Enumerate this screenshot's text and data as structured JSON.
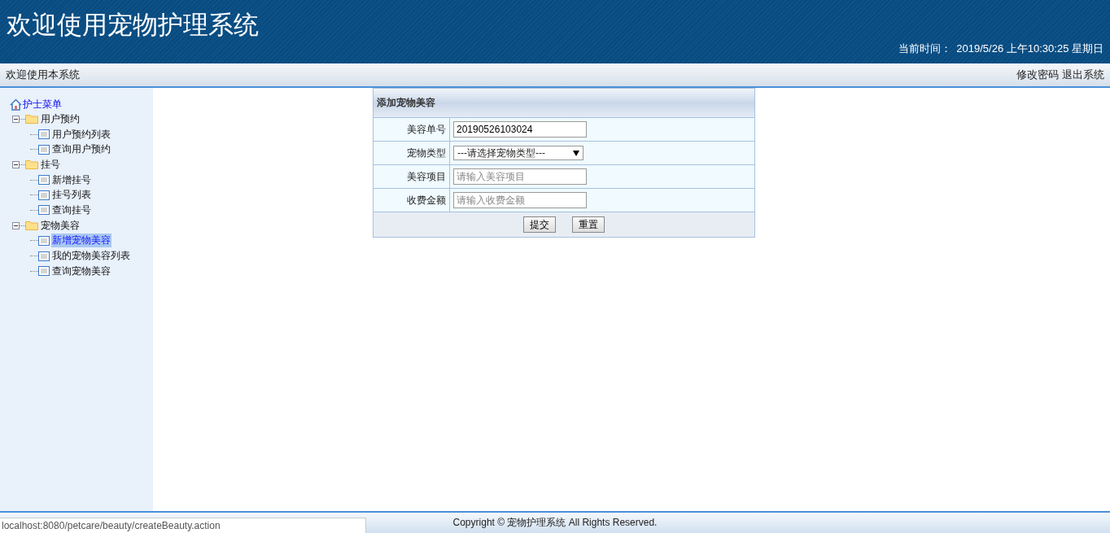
{
  "header": {
    "title": "欢迎使用宠物护理系统",
    "time_label": "当前时间：",
    "time_value": "2019/5/26 上午10:30:25 星期日"
  },
  "nav": {
    "welcome": "欢迎使用本系统",
    "links": [
      "修改密码",
      "退出系统"
    ]
  },
  "sidebar": {
    "root": "护士菜单",
    "children": [
      {
        "label": "用户预约",
        "expanded": true,
        "children": [
          {
            "label": "用户预约列表",
            "selected": false
          },
          {
            "label": "查询用户预约",
            "selected": false
          }
        ]
      },
      {
        "label": "挂号",
        "expanded": true,
        "children": [
          {
            "label": "新增挂号",
            "selected": false
          },
          {
            "label": "挂号列表",
            "selected": false
          },
          {
            "label": "查询挂号",
            "selected": false
          }
        ]
      },
      {
        "label": "宠物美容",
        "expanded": true,
        "children": [
          {
            "label": "新增宠物美容",
            "selected": true
          },
          {
            "label": "我的宠物美容列表",
            "selected": false
          },
          {
            "label": "查询宠物美容",
            "selected": false
          }
        ]
      }
    ]
  },
  "form": {
    "title": "添加宠物美容",
    "fields": [
      {
        "kind": "text",
        "label": "美容单号",
        "value": "20190526103024"
      },
      {
        "kind": "select",
        "label": "宠物类型",
        "value": "---请选择宠物类型---"
      },
      {
        "kind": "text",
        "label": "美容项目",
        "placeholder": "请输入美容项目"
      },
      {
        "kind": "text",
        "label": "收费金额",
        "placeholder": "请输入收费金额"
      }
    ],
    "buttons": [
      "提交",
      "重置"
    ]
  },
  "footer": {
    "copyright": "Copyright © 宠物护理系统 All Rights Reserved."
  },
  "status_url": "localhost:8080/petcare/beauty/createBeauty.action"
}
